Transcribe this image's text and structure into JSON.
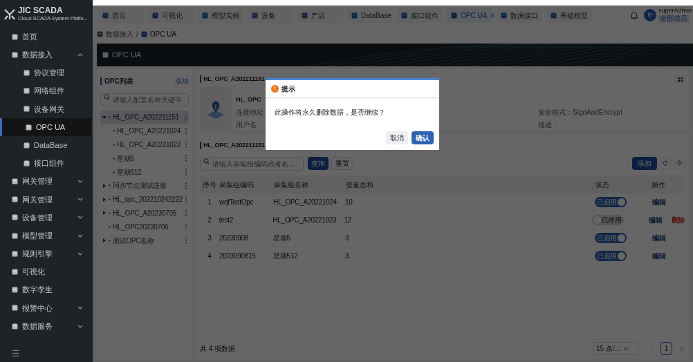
{
  "sidebar": {
    "logo": {
      "title": "JIC SCADA",
      "subtitle": "Cloud SCADA System Platfo..."
    },
    "items": [
      {
        "label": "首页"
      },
      {
        "label": "数据接入",
        "expanded": true,
        "children": [
          {
            "label": "协议管理",
            "selected": false
          },
          {
            "label": "网络组件",
            "selected": false
          },
          {
            "label": "设备网关",
            "selected": false
          },
          {
            "label": "OPC UA",
            "selected": true
          },
          {
            "label": "DataBase",
            "selected": false
          },
          {
            "label": "接口组件",
            "selected": false
          }
        ]
      },
      {
        "label": "网关管理",
        "expanded": false
      },
      {
        "label": "网关管理",
        "expanded": false
      },
      {
        "label": "设备管理",
        "expanded": false
      },
      {
        "label": "模型管理",
        "expanded": false
      },
      {
        "label": "规则引擎",
        "expanded": false
      },
      {
        "label": "可视化"
      },
      {
        "label": "数字孪生"
      },
      {
        "label": "报警中心",
        "expanded": false
      },
      {
        "label": "数据服务",
        "expanded": false
      }
    ],
    "collapse": "☰"
  },
  "tabs": [
    {
      "label": "首页",
      "selected": false
    },
    {
      "label": "可视化",
      "selected": false
    },
    {
      "label": "模型实例",
      "selected": false
    },
    {
      "label": "设备",
      "selected": false
    },
    {
      "label": "产品",
      "selected": false
    },
    {
      "label": "DataBase",
      "selected": false
    },
    {
      "label": "接口组件",
      "selected": false
    },
    {
      "label": "OPC UA",
      "selected": true,
      "close": "×"
    },
    {
      "label": "数据接口",
      "selected": false
    },
    {
      "label": "基础模型",
      "selected": false
    }
  ],
  "user": {
    "avatar": "in",
    "name": "superAdmin",
    "role": "全部成员"
  },
  "breadcrumb": {
    "items": [
      "数据接入",
      "OPC UA"
    ],
    "separator": "/"
  },
  "banner": {
    "title": "OPC UA"
  },
  "opc_list": {
    "title": "OPC列表",
    "add": "添加",
    "placeholder": "请输入配置名称关键字",
    "nodes": [
      {
        "label": "HL_OPC_A202211151",
        "selected": true,
        "expanded": true,
        "children": [
          {
            "label": "HL_OPC_A20221024",
            "selected": false
          },
          {
            "label": "HL_OPC_A20221023",
            "selected": false
          },
          {
            "label": "星期5",
            "selected": false
          },
          {
            "label": "星期512",
            "selected": false
          }
        ]
      },
      {
        "label": "同步节点测试连接",
        "selected": false,
        "expanded": false
      },
      {
        "label": "HL_opc_202210242222",
        "selected": false,
        "expanded": false
      },
      {
        "label": "HL_OPC_A20230705",
        "selected": false,
        "expanded": false
      },
      {
        "label": "HL_OPC20230706",
        "selected": false
      },
      {
        "label": "测试OPC名称",
        "selected": false,
        "expanded": false
      }
    ]
  },
  "details": {
    "title": "HL_OPC_A202211151",
    "name": "HL_OPC",
    "fields": [
      "连接地址",
      "安全模式：SignAndEncrypt",
      "用户名",
      "描述："
    ]
  },
  "collection": {
    "title": "HL_OPC_A202211151",
    "placeholder": "请输入采集组编码或者名...",
    "search": "查询",
    "reset": "重置",
    "add": "添加",
    "table": {
      "columns": [
        "序号",
        "采集组编码",
        "采集组名称",
        "变量总和",
        "状态",
        "操作"
      ],
      "rows": [
        {
          "index": "1",
          "code": "wqfTestOpc",
          "name": "HL_OPC_A20221024",
          "total": "10",
          "status": "已启用",
          "on": true,
          "actions": [
            {
              "label": "编辑",
              "kind": "edit"
            }
          ]
        },
        {
          "index": "2",
          "code": "test2",
          "name": "HL_OPC_A20221023",
          "total": "12",
          "status": "已停用",
          "on": false,
          "actions": [
            {
              "label": "编辑",
              "kind": "edit"
            },
            {
              "label": "删除",
              "kind": "delete"
            }
          ]
        },
        {
          "index": "3",
          "code": "20230908",
          "name": "星期5",
          "total": "3",
          "status": "已启用",
          "on": true,
          "actions": [
            {
              "label": "编辑",
              "kind": "edit"
            }
          ]
        },
        {
          "index": "4",
          "code": "2023090815",
          "name": "星期512",
          "total": "3",
          "status": "已启用",
          "on": true,
          "actions": [
            {
              "label": "编辑",
              "kind": "edit"
            }
          ]
        }
      ]
    },
    "total": "共 4 项数据",
    "page_size": "15 条/...",
    "page": "1"
  },
  "dialog": {
    "title": "提示",
    "icon": "!",
    "message": "此操作将永久删除数据，是否继续？",
    "buttons": [
      {
        "label": "取消",
        "kind": "cancel"
      },
      {
        "label": "确认",
        "kind": "primary"
      }
    ]
  }
}
